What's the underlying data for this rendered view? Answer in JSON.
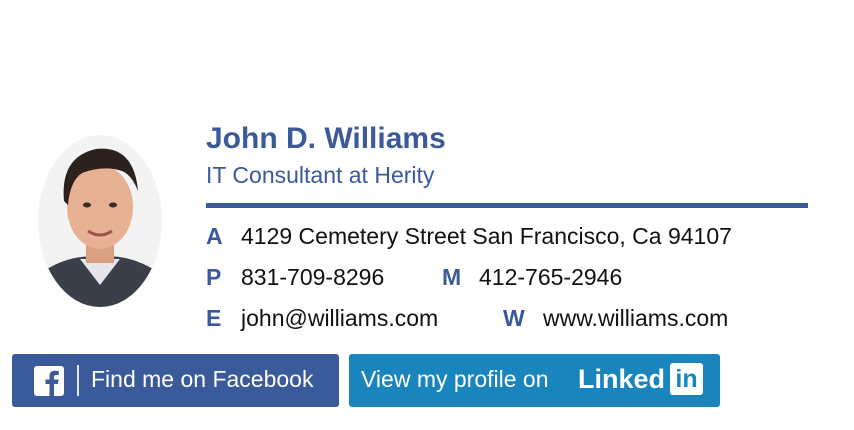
{
  "person": {
    "name": "John D. Williams",
    "title": "IT Consultant at Herity"
  },
  "contact": {
    "address_label": "A",
    "address": "4129 Cemetery Street San Francisco, Ca 94107",
    "phone_label": "P",
    "phone": "831-709-8296",
    "mobile_label": "M",
    "mobile": "412-765-2946",
    "email_label": "E",
    "email": "john@williams.com",
    "web_label": "W",
    "web": "www.williams.com"
  },
  "buttons": {
    "facebook_label": "Find me on Facebook",
    "linkedin_label": "View my profile on",
    "linkedin_word": "Linked",
    "linkedin_box": "in"
  },
  "colors": {
    "accent": "#3b5a9a",
    "facebook": "#3b5a9a",
    "linkedin": "#1a84bd"
  },
  "icons": {
    "facebook": "facebook-icon",
    "linkedin": "linkedin-icon"
  }
}
